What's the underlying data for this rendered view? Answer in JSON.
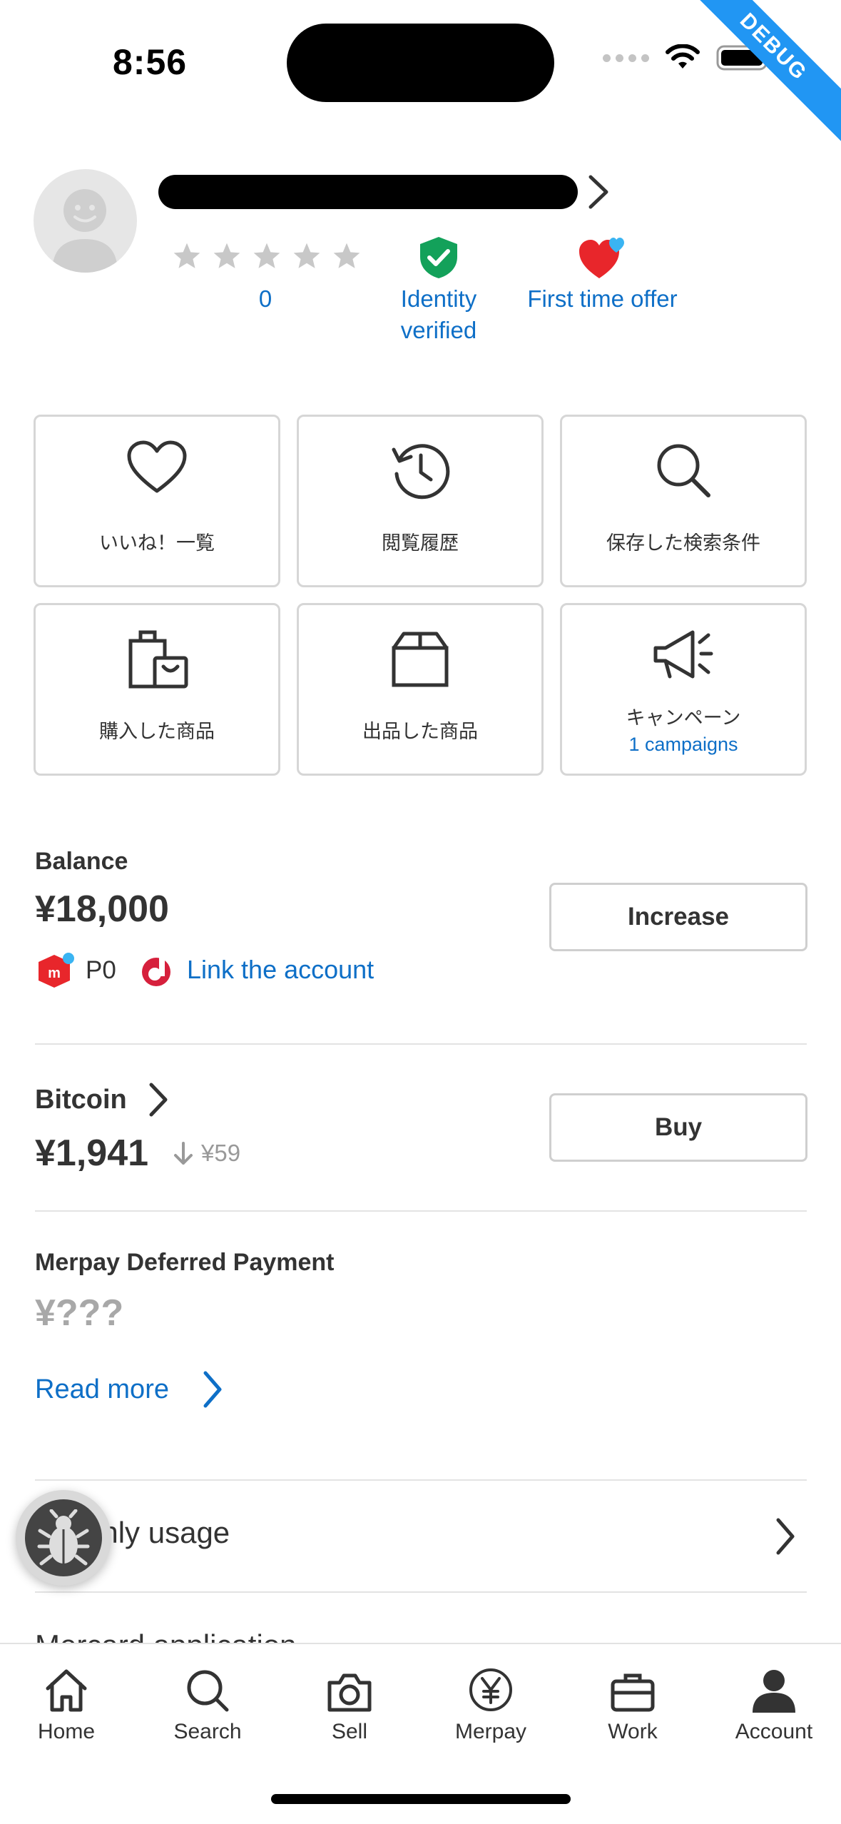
{
  "status_bar": {
    "time": "8:56",
    "debug_label": "DEBUG"
  },
  "profile": {
    "rating_count": "0",
    "badges": [
      {
        "label_line1": "Identity",
        "label_line2": "verified"
      },
      {
        "label_line1": "First time offer"
      }
    ]
  },
  "tiles": [
    {
      "label": "いいね！一覧",
      "icon": "heart-icon"
    },
    {
      "label": "閲覧履歴",
      "icon": "history-icon"
    },
    {
      "label": "保存した検索条件",
      "icon": "search-icon"
    },
    {
      "label": "購入した商品",
      "icon": "shopping-bag-icon"
    },
    {
      "label": "出品した商品",
      "icon": "box-icon"
    },
    {
      "label": "キャンペーン",
      "sub": "1 campaigns",
      "icon": "megaphone-icon"
    }
  ],
  "balance": {
    "title": "Balance",
    "amount": "¥18,000",
    "points": "P0",
    "link_label": "Link the account",
    "button_label": "Increase"
  },
  "bitcoin": {
    "title": "Bitcoin",
    "amount": "¥1,941",
    "change": "¥59",
    "button_label": "Buy"
  },
  "deferred": {
    "title": "Merpay Deferred Payment",
    "amount": "¥???",
    "read_more": "Read more"
  },
  "list_rows": [
    {
      "label": "Monthly usage"
    },
    {
      "label": "Mercard application"
    }
  ],
  "nav": [
    {
      "label": "Home",
      "icon": "home-icon"
    },
    {
      "label": "Search",
      "icon": "search-icon"
    },
    {
      "label": "Sell",
      "icon": "camera-icon"
    },
    {
      "label": "Merpay",
      "icon": "yen-icon"
    },
    {
      "label": "Work",
      "icon": "briefcase-icon"
    },
    {
      "label": "Account",
      "icon": "person-icon"
    }
  ],
  "colors": {
    "link": "#0e6fc7",
    "verified": "#13a15a",
    "heart": "#e8262b",
    "debug": "#2196f3"
  }
}
